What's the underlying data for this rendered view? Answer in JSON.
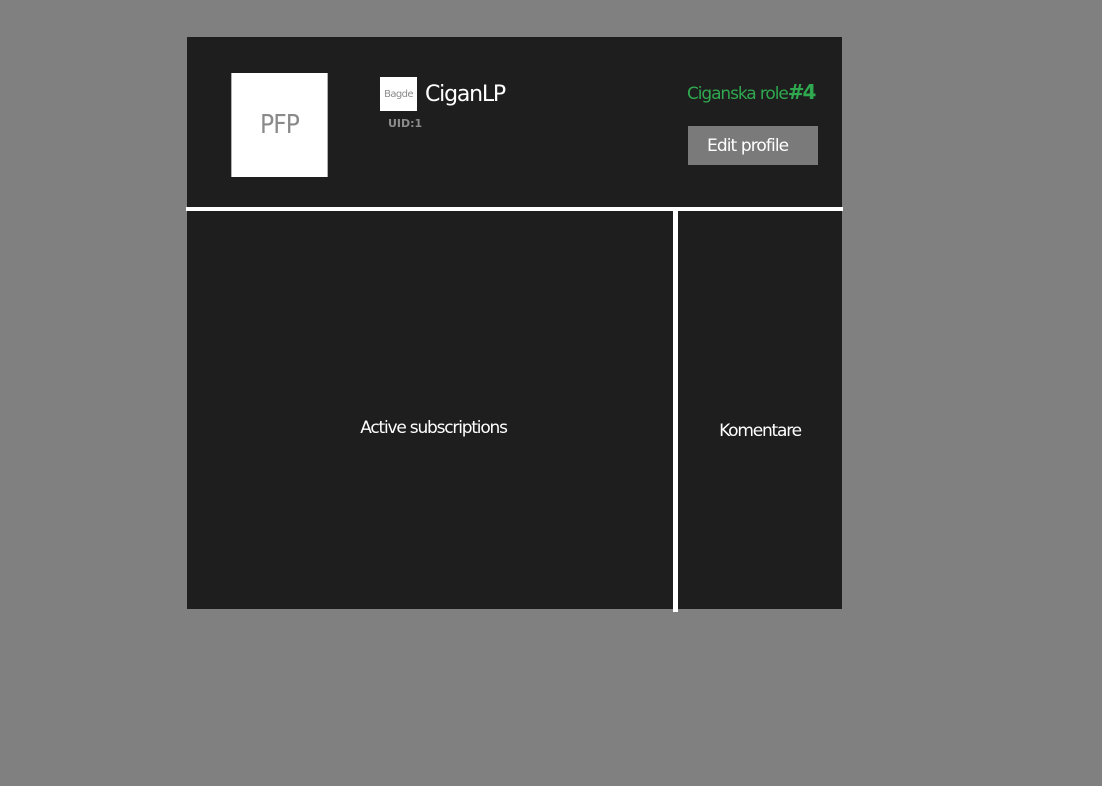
{
  "profile": {
    "avatar_text": "PFP",
    "badge_text": "Bagde",
    "username": "CiganLP",
    "uid": "UID:1",
    "role_text": "Ciganska role",
    "role_number": "#4",
    "edit_label": "Edit profile",
    "role_color": "#2fa84f"
  },
  "sections": {
    "subscriptions_label": "Active subscriptions",
    "comments_label": "Komentare"
  }
}
